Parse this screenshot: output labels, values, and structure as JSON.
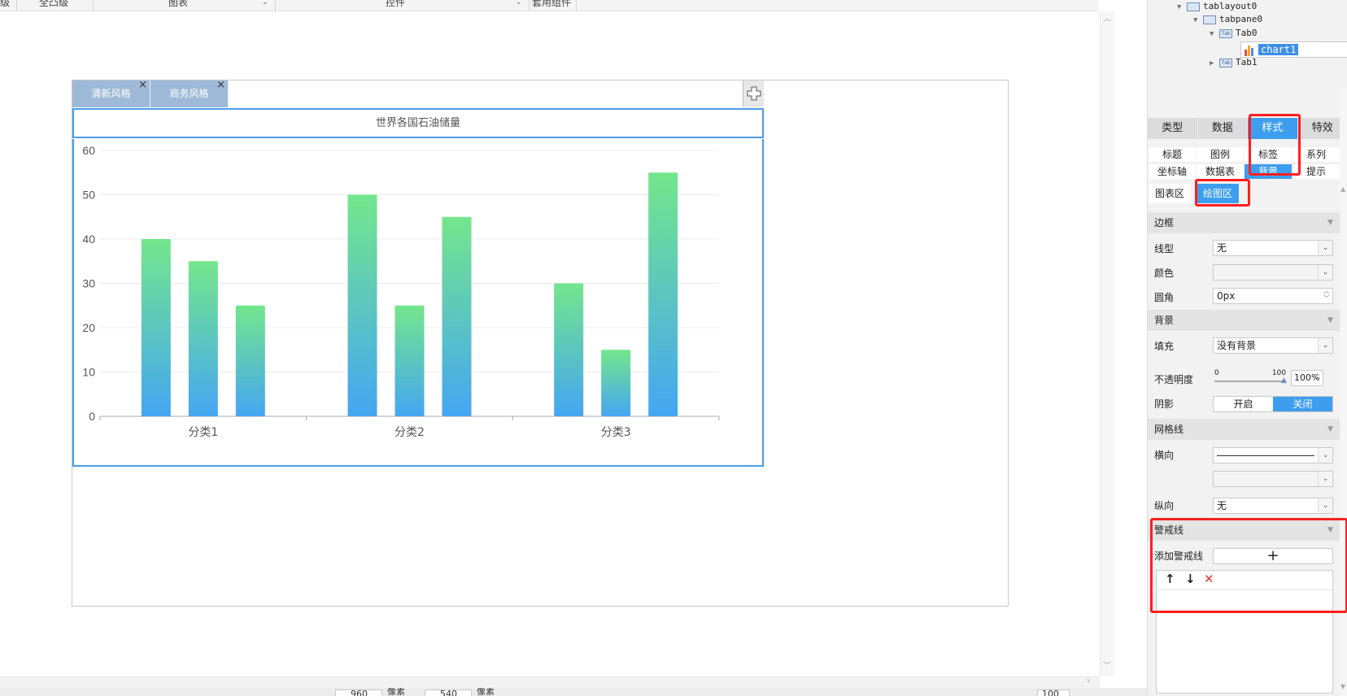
{
  "toolbar": {
    "items": [
      "级",
      "全凸级",
      "图表",
      "控件",
      "套用组件"
    ]
  },
  "canvas": {
    "tabs": [
      {
        "label": "清新风格"
      },
      {
        "label": "商务风格"
      }
    ],
    "add_tab_icon": "plus-square-icon",
    "close_glyph": "×"
  },
  "chart_data": {
    "type": "bar",
    "title": "世界各国石油储量",
    "categories": [
      "分类1",
      "分类2",
      "分类3"
    ],
    "series": [
      {
        "values": [
          40,
          50,
          30
        ]
      },
      {
        "values": [
          35,
          25,
          15
        ]
      },
      {
        "values": [
          25,
          45,
          55
        ]
      }
    ],
    "ylim": [
      0,
      60
    ],
    "yticks": [
      0,
      10,
      20,
      30,
      40,
      50,
      60
    ],
    "grid": true,
    "legend": "none",
    "gradient": {
      "top": "#74e68c",
      "bottom": "#45a6f2"
    }
  },
  "status": {
    "width_value": "960",
    "width_unit": "像素",
    "height_value": "540",
    "height_unit": "像素",
    "zoom": "100"
  },
  "tree": {
    "nodes": [
      {
        "label": "tablayout0"
      },
      {
        "label": "tabpane0"
      },
      {
        "label": "Tab0"
      },
      {
        "label": "chart1"
      },
      {
        "label": "Tab1"
      }
    ],
    "tab_icon_text": "Tab"
  },
  "panel": {
    "main_tabs": [
      "类型",
      "数据",
      "样式",
      "特效"
    ],
    "sub_tabs": [
      "标题",
      "图例",
      "标签",
      "系列",
      "坐标轴",
      "数据表",
      "背景",
      "提示"
    ],
    "area_tabs": [
      "图表区",
      "绘图区"
    ],
    "border": {
      "section": "边框",
      "linetype_label": "线型",
      "linetype_value": "无",
      "color_label": "颜色",
      "radius_label": "圆角",
      "radius_value": "0px"
    },
    "background": {
      "section": "背景",
      "fill_label": "填充",
      "fill_value": "没有背景",
      "opacity_label": "不透明度",
      "opacity_min": "0",
      "opacity_max": "100",
      "opacity_value": "100%",
      "opacity_level": 1.0,
      "shadow_label": "阴影",
      "shadow_on": "开启",
      "shadow_off": "关闭"
    },
    "gridlines": {
      "section": "网格线",
      "horizontal_label": "横向",
      "vertical_label": "纵向",
      "vertical_value": "无"
    },
    "warning": {
      "section": "警戒线",
      "add_label": "添加警戒线",
      "add_glyph": "+",
      "up_glyph": "↑",
      "down_glyph": "↓",
      "delete_glyph": "✕"
    },
    "accent_color": "#3d9ef0",
    "highlight_color": "#ff1f1f"
  }
}
